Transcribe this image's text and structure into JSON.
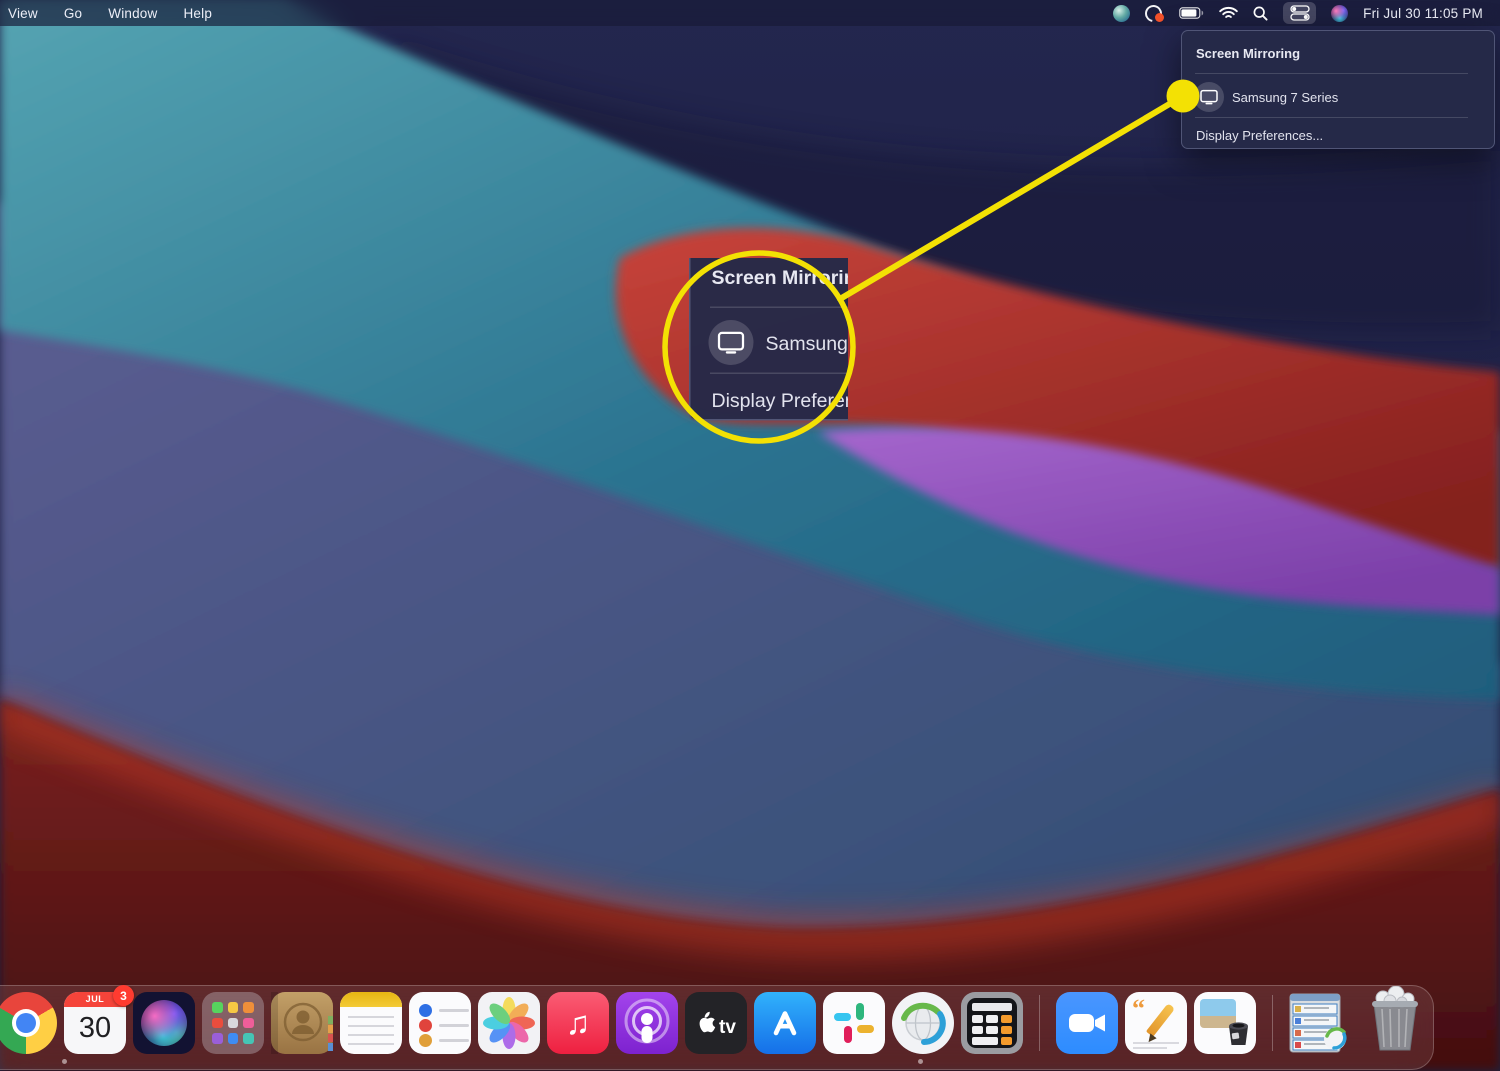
{
  "menu_bar": {
    "menus": [
      "View",
      "Go",
      "Window",
      "Help"
    ],
    "clock": "Fri Jul 30 11:05 PM",
    "status_icons": [
      "globe-icon",
      "creative-cloud-icon",
      "battery-icon",
      "wifi-icon",
      "search-icon",
      "control-center-icon",
      "siri-icon"
    ]
  },
  "screen_mirroring_menu": {
    "title": "Screen Mirroring",
    "device_icon": "display-icon",
    "device_label": "Samsung 7 Series",
    "preferences_label": "Display Preferences..."
  },
  "colors": {
    "accent_yellow": "#f3e104",
    "menu_panel_bg": "#252948",
    "menubar_bg": "#181b36"
  },
  "dock": {
    "calendar": {
      "month": "JUL",
      "day": "30",
      "badge": "3"
    },
    "appletv_label": "tv",
    "glyphs": {
      "music_note": "♫",
      "pages_quote": "“"
    },
    "apps": [
      "chrome",
      "calendar",
      "siri",
      "launchpad",
      "contacts",
      "notes",
      "reminders",
      "photos",
      "music",
      "podcasts",
      "apple-tv",
      "app-store",
      "slack",
      "anyconnect-vpn",
      "calculator",
      "zoom",
      "pages",
      "preview",
      "minimized-window",
      "trash"
    ],
    "running": [
      "chrome",
      "anyconnect-vpn"
    ]
  }
}
